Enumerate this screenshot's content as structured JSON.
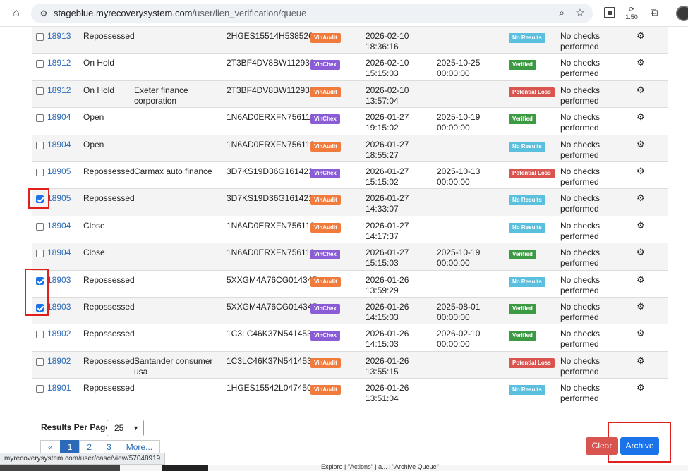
{
  "browser": {
    "url_host": "stageblue.myrecoverysystem.com",
    "url_path": "/user/lien_verification/queue",
    "extension_label": "1.50"
  },
  "rows": [
    {
      "id": "18913",
      "status": "Repossessed",
      "lienholder": "",
      "vin": "2HGES15514H538526",
      "provider": "VinAudit",
      "date1": "2026-02-10",
      "time1": "18:36:16",
      "date2": "",
      "time2": "",
      "result": "No Results",
      "checks1": "No checks",
      "checks2": "performed",
      "checked": false
    },
    {
      "id": "18912",
      "status": "On Hold",
      "lienholder": "",
      "vin": "2T3BF4DV8BW112936",
      "provider": "VinChex",
      "date1": "2026-02-10",
      "time1": "15:15:03",
      "date2": "2025-10-25",
      "time2": "00:00:00",
      "result": "Verified",
      "checks1": "No checks",
      "checks2": "performed",
      "checked": false
    },
    {
      "id": "18912",
      "status": "On Hold",
      "lienholder": "Exeter finance corporation",
      "vin": "2T3BF4DV8BW112936",
      "provider": "VinAudit",
      "date1": "2026-02-10",
      "time1": "13:57:04",
      "date2": "",
      "time2": "",
      "result": "Potential Loss",
      "checks1": "No checks",
      "checks2": "performed",
      "checked": false
    },
    {
      "id": "18904",
      "status": "Open",
      "lienholder": "",
      "vin": "1N6AD0ERXFN756119",
      "provider": "VinChex",
      "date1": "2026-01-27",
      "time1": "19:15:02",
      "date2": "2025-10-19",
      "time2": "00:00:00",
      "result": "Verified",
      "checks1": "No checks",
      "checks2": "performed",
      "checked": false
    },
    {
      "id": "18904",
      "status": "Open",
      "lienholder": "",
      "vin": "1N6AD0ERXFN756119",
      "provider": "VinAudit",
      "date1": "2026-01-27",
      "time1": "18:55:27",
      "date2": "",
      "time2": "",
      "result": "No Results",
      "checks1": "No checks",
      "checks2": "performed",
      "checked": false
    },
    {
      "id": "18905",
      "status": "Repossessed",
      "lienholder": "Carmax auto finance",
      "vin": "3D7KS19D36G161421",
      "provider": "VinChex",
      "date1": "2026-01-27",
      "time1": "15:15:02",
      "date2": "2025-10-13",
      "time2": "00:00:00",
      "result": "Potential Loss",
      "checks1": "No checks",
      "checks2": "performed",
      "checked": false
    },
    {
      "id": "18905",
      "status": "Repossessed",
      "lienholder": "",
      "vin": "3D7KS19D36G161421",
      "provider": "VinAudit",
      "date1": "2026-01-27",
      "time1": "14:33:07",
      "date2": "",
      "time2": "",
      "result": "No Results",
      "checks1": "No checks",
      "checks2": "performed",
      "checked": true
    },
    {
      "id": "18904",
      "status": "Close",
      "lienholder": "",
      "vin": "1N6AD0ERXFN756119",
      "provider": "VinAudit",
      "date1": "2026-01-27",
      "time1": "14:17:37",
      "date2": "",
      "time2": "",
      "result": "No Results",
      "checks1": "No checks",
      "checks2": "performed",
      "checked": false
    },
    {
      "id": "18904",
      "status": "Close",
      "lienholder": "",
      "vin": "1N6AD0ERXFN756119",
      "provider": "VinChex",
      "date1": "2026-01-27",
      "time1": "15:15:03",
      "date2": "2025-10-19",
      "time2": "00:00:00",
      "result": "Verified",
      "checks1": "No checks",
      "checks2": "performed",
      "checked": false
    },
    {
      "id": "18903",
      "status": "Repossessed",
      "lienholder": "",
      "vin": "5XXGM4A76CG014347",
      "provider": "VinAudit",
      "date1": "2026-01-26",
      "time1": "13:59:29",
      "date2": "",
      "time2": "",
      "result": "No Results",
      "checks1": "No checks",
      "checks2": "performed",
      "checked": true
    },
    {
      "id": "18903",
      "status": "Repossessed",
      "lienholder": "",
      "vin": "5XXGM4A76CG014347",
      "provider": "VinChex",
      "date1": "2026-01-26",
      "time1": "14:15:03",
      "date2": "2025-08-01",
      "time2": "00:00:00",
      "result": "Verified",
      "checks1": "No checks",
      "checks2": "performed",
      "checked": true
    },
    {
      "id": "18902",
      "status": "Repossessed",
      "lienholder": "",
      "vin": "1C3LC46K37N541453",
      "provider": "VinChex",
      "date1": "2026-01-26",
      "time1": "14:15:03",
      "date2": "2026-02-10",
      "time2": "00:00:00",
      "result": "Verified",
      "checks1": "No checks",
      "checks2": "performed",
      "checked": false
    },
    {
      "id": "18902",
      "status": "Repossessed",
      "lienholder": "Santander consumer usa",
      "vin": "1C3LC46K37N541453",
      "provider": "VinAudit",
      "date1": "2026-01-26",
      "time1": "13:55:15",
      "date2": "",
      "time2": "",
      "result": "Potential Loss",
      "checks1": "No checks",
      "checks2": "performed",
      "checked": false
    },
    {
      "id": "18901",
      "status": "Repossessed",
      "lienholder": "",
      "vin": "1HGES15542L047450",
      "provider": "VinAudit",
      "date1": "2026-01-26",
      "time1": "13:51:04",
      "date2": "",
      "time2": "",
      "result": "No Results",
      "checks1": "No checks",
      "checks2": "performed",
      "checked": false
    }
  ],
  "footer": {
    "results_per_page_label": "Results Per Page:",
    "results_per_page_value": "25",
    "pagination": [
      "«",
      "1",
      "2",
      "3",
      "More..."
    ],
    "active_page": "1",
    "clear_label": "Clear",
    "archive_label": "Archive"
  },
  "status_bar_url": "myrecoverysystem.com/user/case/view/57048919",
  "bottom_text": "Explore | \"Actions\" | a... | \"Archive Queue\""
}
